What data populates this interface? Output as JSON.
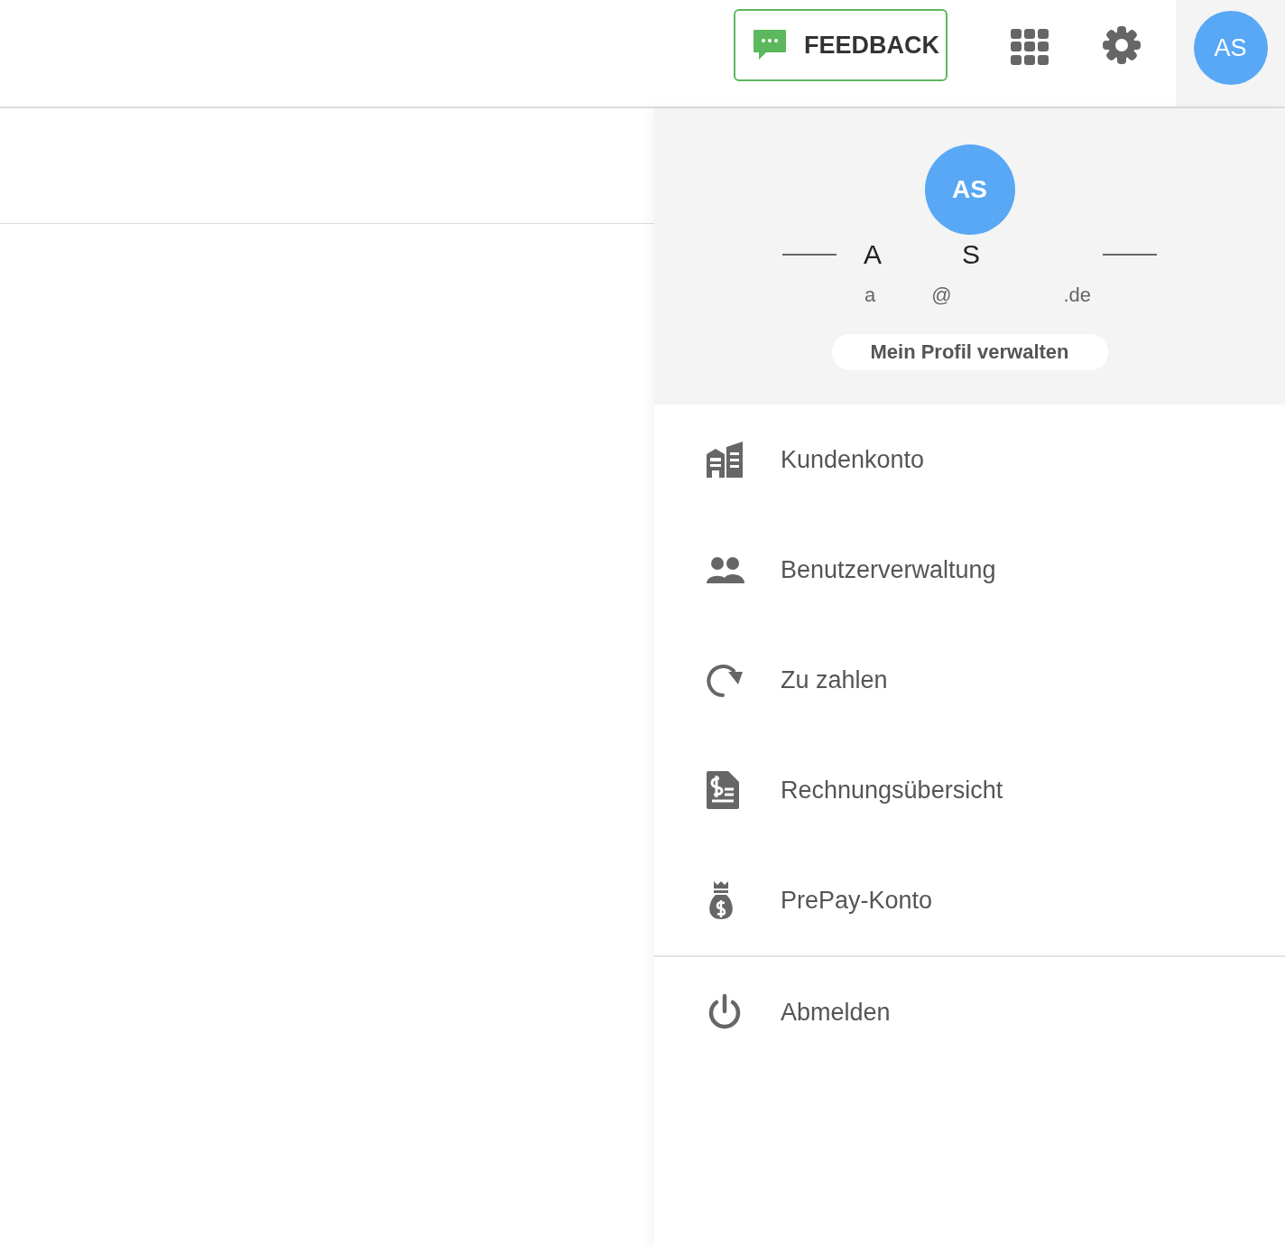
{
  "topbar": {
    "feedback": "FEEDBACK",
    "avatar": "AS"
  },
  "profile": {
    "avatar": "AS",
    "name_parts": [
      "A",
      "S"
    ],
    "email_parts": [
      "a",
      "@",
      ".de"
    ],
    "manage_button": "Mein Profil verwalten"
  },
  "menu": [
    {
      "kind": "building",
      "label": "Kundenkonto"
    },
    {
      "kind": "users",
      "label": "Benutzerverwaltung"
    },
    {
      "kind": "redo",
      "label": "Zu zahlen"
    },
    {
      "kind": "invoice",
      "label": "Rechnungsübersicht"
    },
    {
      "kind": "moneybag",
      "label": "PrePay-Konto"
    }
  ],
  "logout": {
    "kind": "power",
    "label": "Abmelden"
  }
}
